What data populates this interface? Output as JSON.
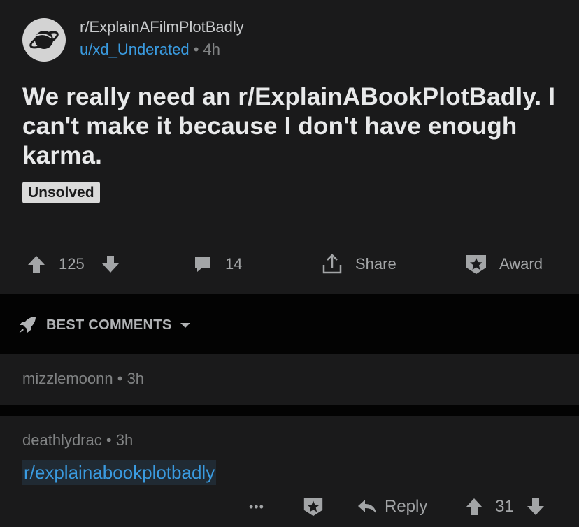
{
  "post": {
    "subreddit": "r/ExplainAFilmPlotBadly",
    "author": "u/xd_Underated",
    "separator": "•",
    "age": "4h",
    "title": "We really need an r/ExplainABookPlotBadly. I can't make it because I don't have enough karma.",
    "flair": "Unsolved",
    "votes": "125",
    "comments_count": "14",
    "share_label": "Share",
    "award_label": "Award"
  },
  "sort": {
    "label": "BEST COMMENTS"
  },
  "comments": [
    {
      "author": "mizzlemoonn",
      "separator": "•",
      "age": "3h"
    },
    {
      "author": "deathlydrac",
      "separator": "•",
      "age": "3h",
      "body": "r/explainabookplotbadly",
      "more": "•••",
      "reply_label": "Reply",
      "votes": "31"
    }
  ],
  "colors": {
    "background": "#1a1a1b",
    "link": "#3a9be0",
    "bar": "#030303"
  }
}
